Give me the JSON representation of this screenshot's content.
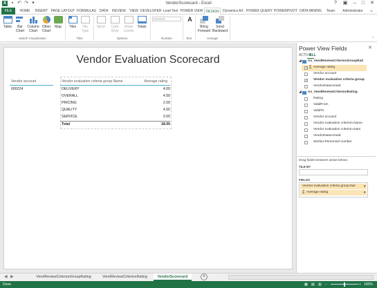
{
  "window": {
    "title": "VendorScorecard - Excel",
    "user": "Administrator"
  },
  "tabs": [
    "FILE",
    "HOME",
    "INSERT",
    "PAGE LAYOUT",
    "FORMULAS",
    "DATA",
    "REVIEW",
    "VIEW",
    "DEVELOPER",
    "Load Test",
    "POWER VIEW",
    "DESIGN",
    "Dynamics AX",
    "POWER QUERY",
    "POWERPIVOT",
    "DATA MINING",
    "Team"
  ],
  "active_tab": "DESIGN",
  "ribbon": {
    "switch_viz": [
      "Table",
      "Bar Chart",
      "Column Chart",
      "Other Chart",
      "Map"
    ],
    "tiles": [
      "Tiles",
      "Tile Type"
    ],
    "options": [
      "Slicer",
      "Card Style",
      "Show Levels",
      "Totals"
    ],
    "number_format": "General",
    "arrange": [
      "Bring Forward",
      "Send Backward"
    ],
    "groups": [
      "Switch Visualization",
      "Tiles",
      "Options",
      "Number",
      "Text",
      "Arrange"
    ]
  },
  "report": {
    "title": "Vendor Evaluation Scorecard",
    "vendor_header": "Vendor account",
    "vendor_value": "000224",
    "col_group": "Vendor evaluation criteria group.Name",
    "col_avg": "Average rating",
    "rows": [
      {
        "name": "DELIVERY",
        "value": "4.00"
      },
      {
        "name": "OVERALL",
        "value": "4.50"
      },
      {
        "name": "PRICING",
        "value": "2.00"
      },
      {
        "name": "QUALITY",
        "value": "4.50"
      },
      {
        "name": "SERVICE",
        "value": "3.00"
      }
    ],
    "total_label": "Total",
    "total_value": "18.00"
  },
  "pane": {
    "title": "Power View Fields",
    "tab_active": "ACTIVE",
    "tab_all": "ALL",
    "group1": "Ax_VendReviewCriterionGroupRati",
    "group1_fields": [
      {
        "label": "Average rating",
        "checked": true,
        "sigma": true,
        "highlight": true
      },
      {
        "label": "Vendor account",
        "checked": false,
        "sigma": false,
        "highlight": false
      },
      {
        "label": "Vendor evaluation criteria group.",
        "checked": true,
        "sigma": false,
        "highlight": false
      },
      {
        "label": "VendorDataAreaId",
        "checked": false,
        "sigma": false,
        "highlight": false
      }
    ],
    "group2": "Ax_VendReviewCriterionRating",
    "group2_fields": [
      "Rating",
      "ValidFrom",
      "ValidTo",
      "Vendor account",
      "Vendor evaluation criterion.Name",
      "Vendor evaluation criterion.Nam",
      "VendorDataAreaId",
      "Worker.Personnel number"
    ],
    "drag_hint": "Drag fields between areas below:",
    "tile_by": "TILE BY",
    "fields_label": "FIELDS",
    "fields_items": [
      "Vendor evaluation criteria group.Nar",
      "Average rating"
    ]
  },
  "sheets": [
    "VendReviewCriterionGroupRating",
    "VendReviewCriterionRating",
    "VendorScorecard"
  ],
  "active_sheet": "VendorScorecard",
  "status": "Done",
  "zoom": "100%"
}
